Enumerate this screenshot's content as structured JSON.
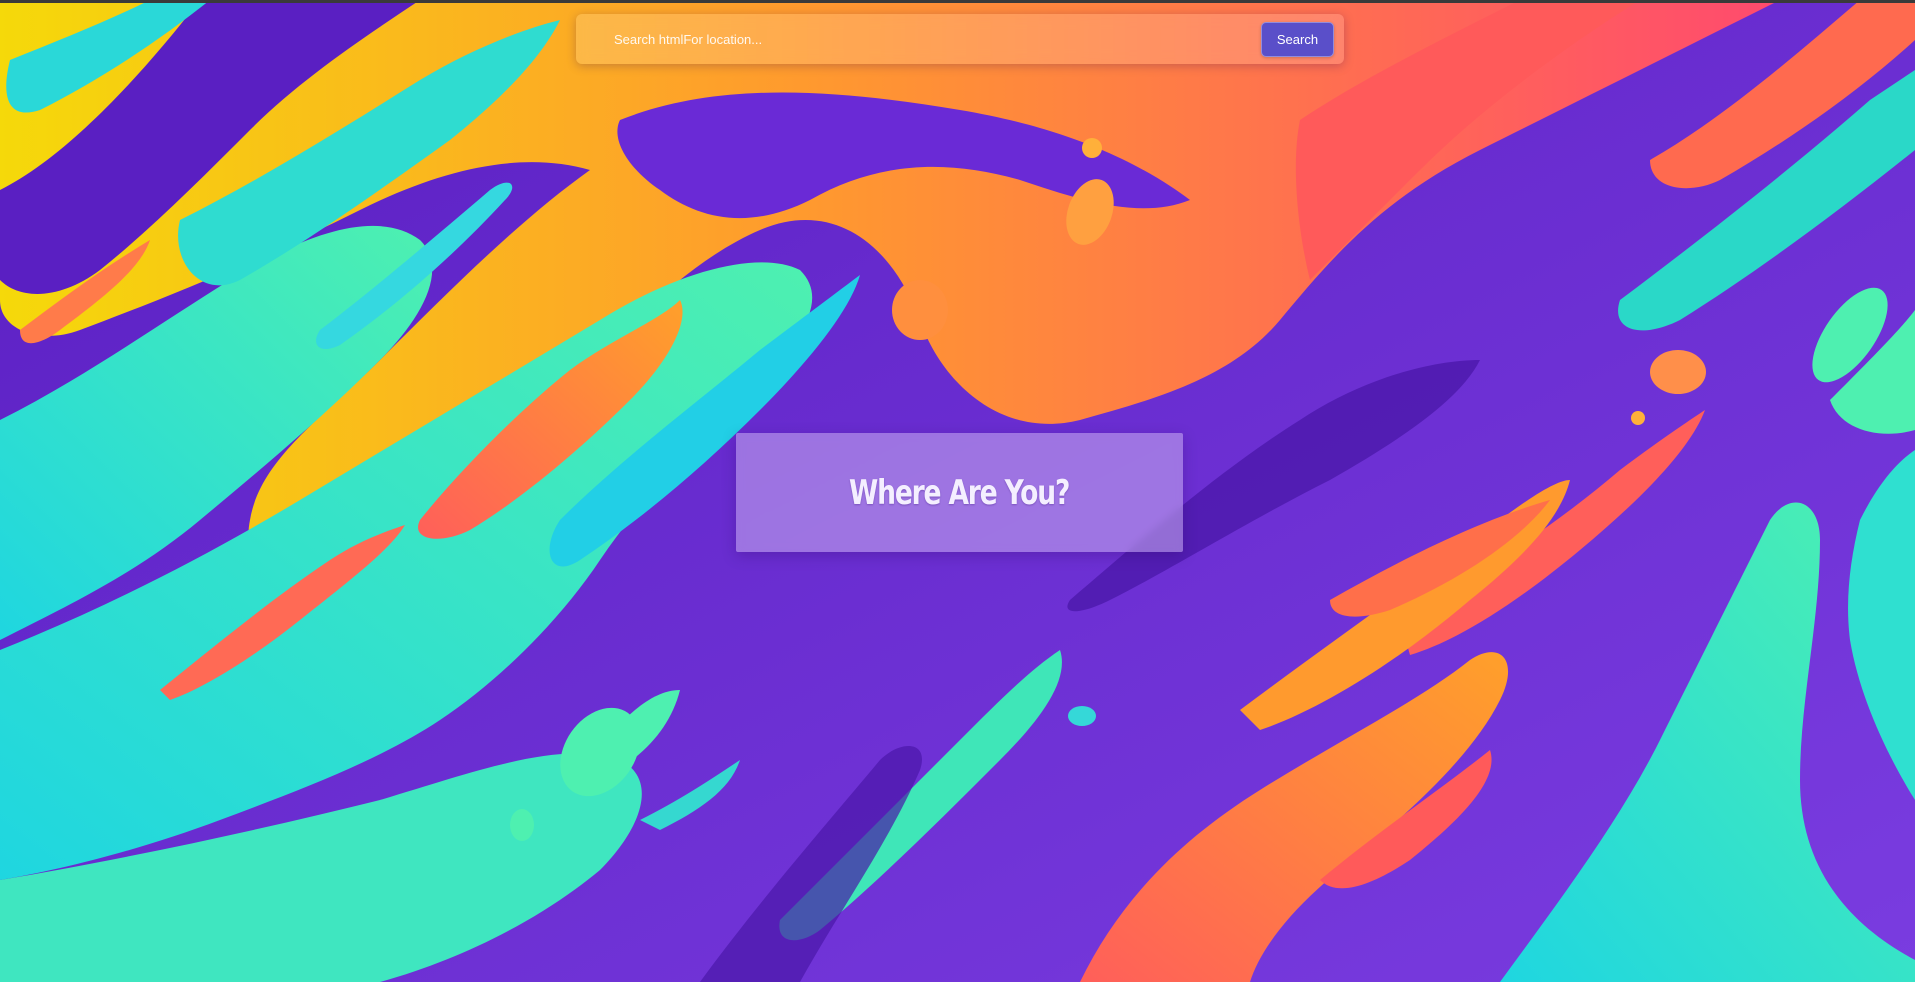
{
  "search": {
    "placeholder": "Search htmlFor location...",
    "value": "",
    "button_label": "Search"
  },
  "hero": {
    "title": "Where Are You?"
  },
  "background": {
    "image": "abstract-fluid-waves",
    "colors": {
      "base_purple": "#5a1fc2",
      "deep_purple": "#4a17a8",
      "cyan": "#1fd6e0",
      "mint": "#4ef0b0",
      "yellow": "#f5d90a",
      "orange": "#ff9a2e",
      "coral": "#ff5f5a",
      "pink_red": "#ff4a6e"
    }
  },
  "theme": {
    "accent": "#5a4fc9"
  }
}
